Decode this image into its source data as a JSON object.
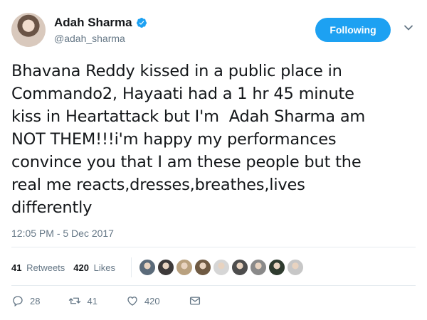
{
  "author": {
    "display_name": "Adah Sharma",
    "handle": "@adah_sharma"
  },
  "follow_button_label": "Following",
  "tweet": {
    "text": "Bhavana Reddy kissed in a public place in\nCommando2, Hayaati had a 1 hr 45 minute\nkiss in Heartattack but I'm  Adah Sharma am\nNOT THEM!!!i'm happy my performances\nconvince you that I am these people but the\nreal me reacts,dresses,breathes,lives\ndifferently",
    "timestamp": "12:05 PM - 5 Dec 2017"
  },
  "stats": {
    "retweets_count": "41",
    "retweets_label": "Retweets",
    "likes_count": "420",
    "likes_label": "Likes",
    "liker_avatars": [
      "#5b6b7a",
      "#3d3a3a",
      "#b9a17f",
      "#6f5a43",
      "#d6d6d6",
      "#4d4d4d",
      "#8a8a8a",
      "#2f3b2f",
      "#c7c7c7"
    ]
  },
  "actions": {
    "reply_count": "28",
    "retweet_count": "41",
    "like_count": "420"
  },
  "colors": {
    "accent": "#1da1f2",
    "muted": "#657786",
    "text": "#14171a",
    "divider": "#e6ecf0"
  },
  "icons": [
    "verified-badge-icon",
    "chevron-down-icon",
    "reply-icon",
    "retweet-icon",
    "like-icon",
    "direct-message-icon"
  ]
}
